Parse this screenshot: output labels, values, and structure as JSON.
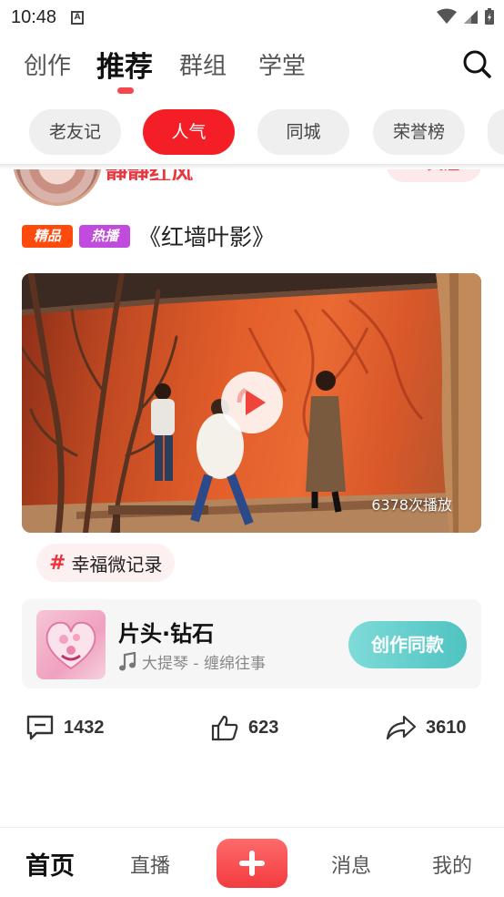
{
  "status_bar": {
    "time": "10:48",
    "notification_glyph": "A"
  },
  "top_tabs": [
    {
      "label": "创作",
      "active": false
    },
    {
      "label": "推荐",
      "active": true
    },
    {
      "label": "群组",
      "active": false
    },
    {
      "label": "学堂",
      "active": false
    }
  ],
  "chips": [
    {
      "label": "老友记",
      "active": false
    },
    {
      "label": "人气",
      "active": true
    },
    {
      "label": "同城",
      "active": false
    },
    {
      "label": "荣誉榜",
      "active": false
    }
  ],
  "post": {
    "author_name": "静静红风",
    "follow_label": "+ 关注",
    "badges": [
      "精品",
      "热播"
    ],
    "title": "《红墙叶影》",
    "play_count": "6378次播放",
    "topic": "幸福微记录",
    "music": {
      "title": "片头·钻石",
      "subtitle": "大提琴 - 缠绵往事",
      "create_label": "创作同款"
    },
    "stats": {
      "comments": "1432",
      "likes": "623",
      "shares": "3610"
    }
  },
  "bottom_nav": {
    "home": "首页",
    "live": "直播",
    "messages": "消息",
    "mine": "我的"
  },
  "colors": {
    "accent": "#f41f26",
    "teal": "#4fc3c1",
    "badge_orange": "#ff4a0e",
    "badge_purple": "#c14bdd"
  },
  "icons": [
    "search-icon",
    "play-icon",
    "music-note-icon",
    "comment-icon",
    "like-icon",
    "share-icon",
    "plus-icon",
    "wifi-icon",
    "signal-icon",
    "battery-icon"
  ]
}
